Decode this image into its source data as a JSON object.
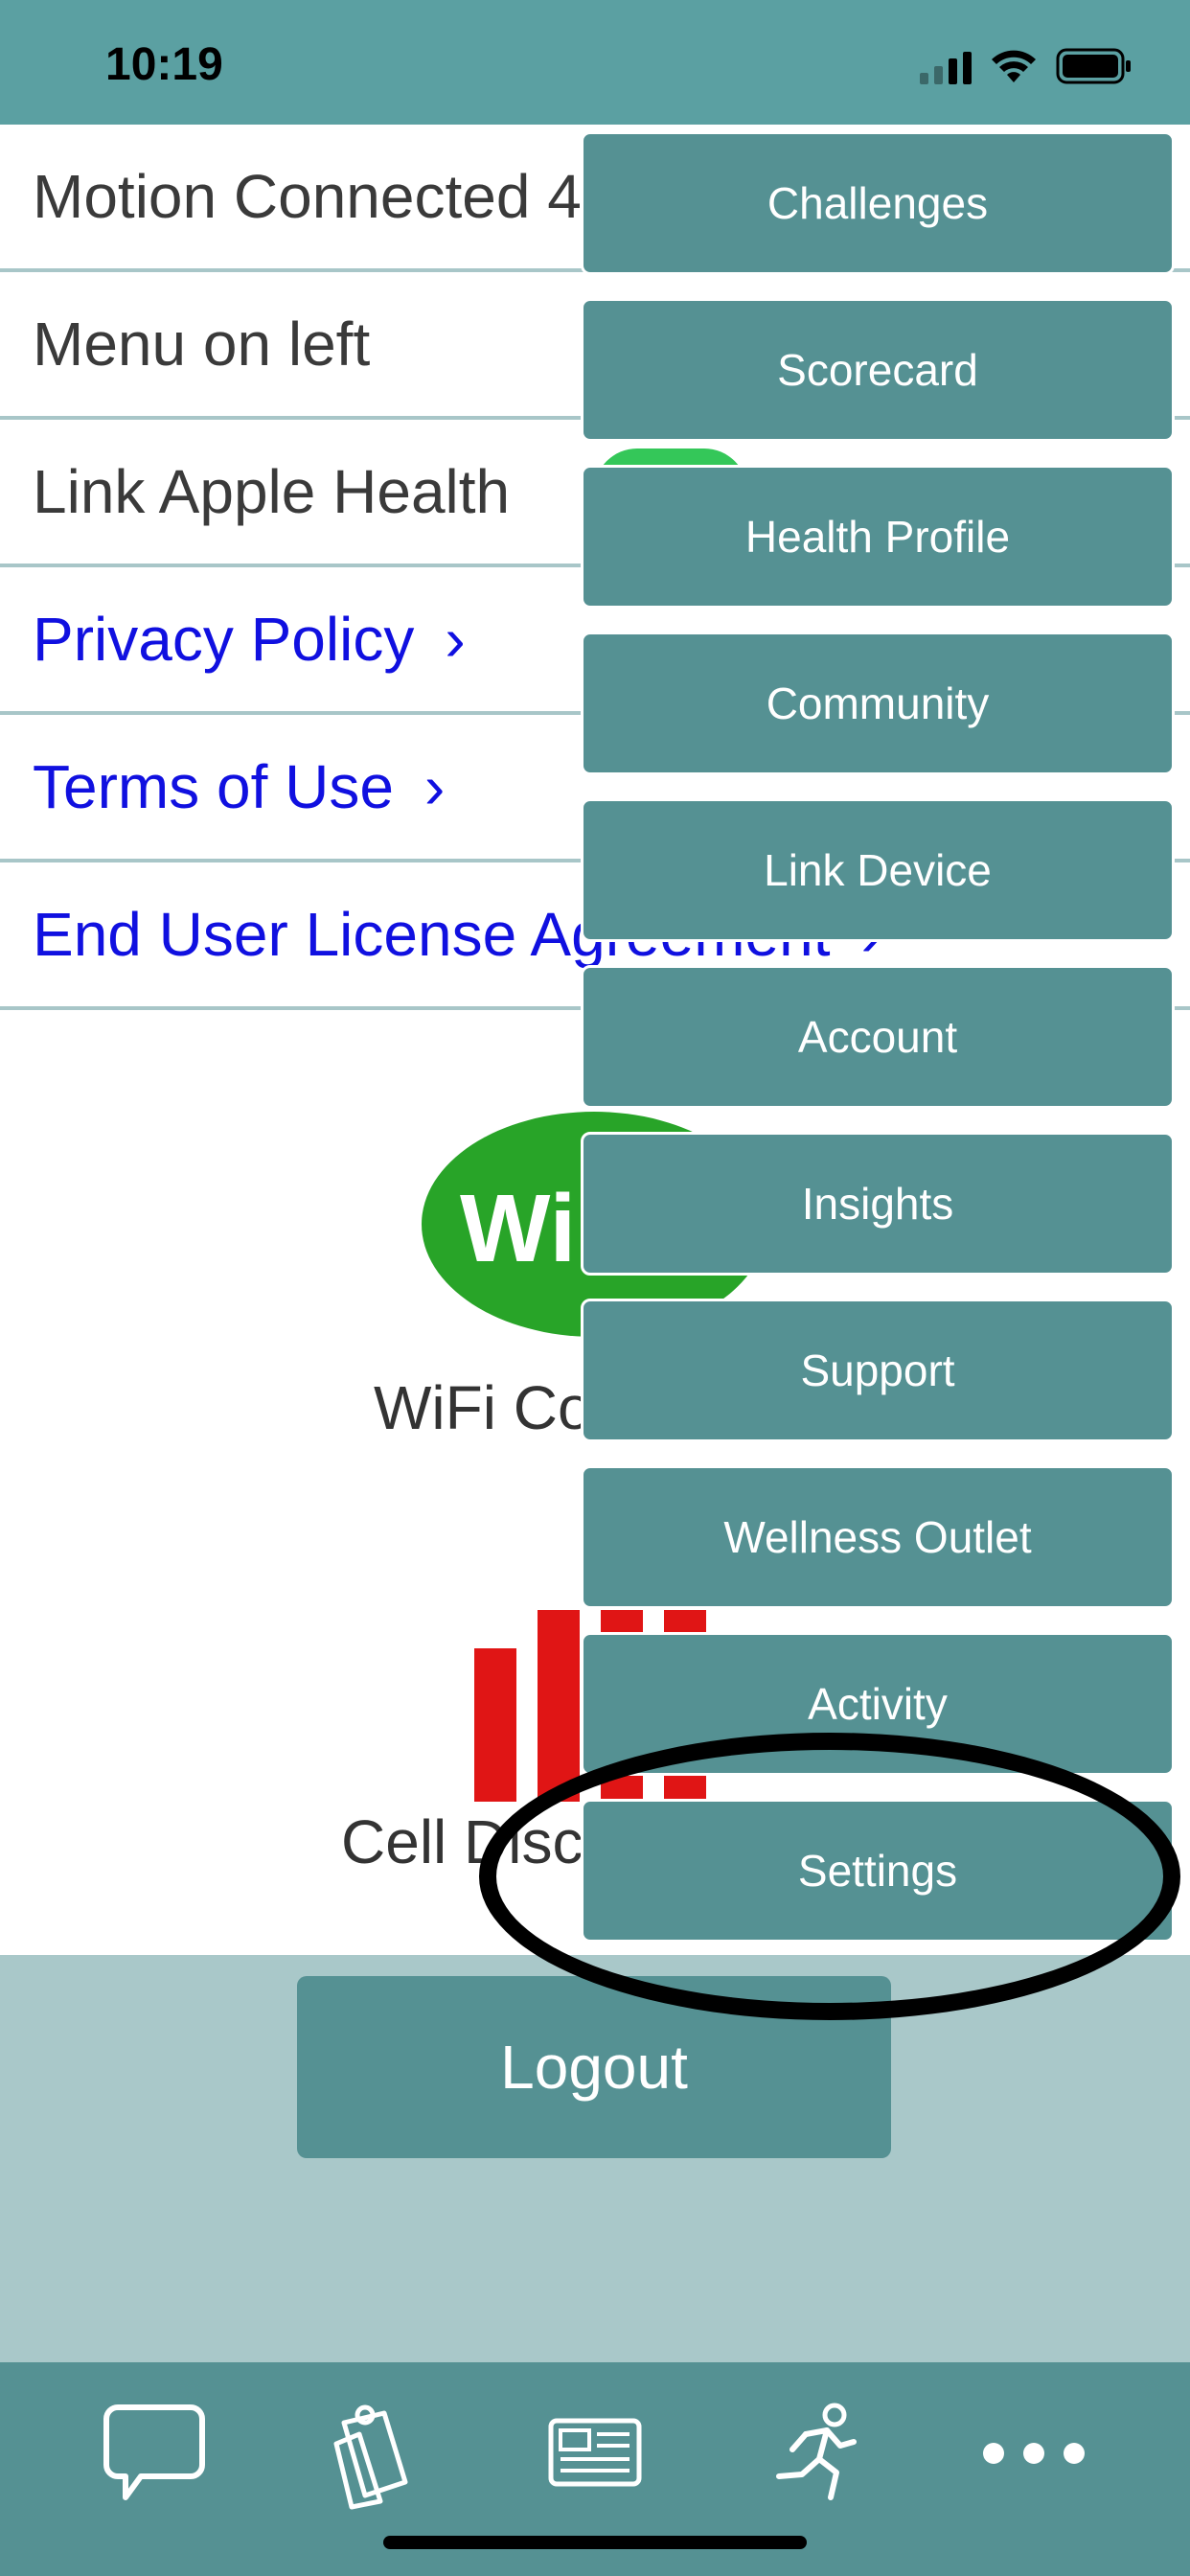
{
  "status_bar": {
    "time": "10:19"
  },
  "settings": {
    "rows": [
      {
        "label": "Motion Connected 4"
      },
      {
        "label": "Menu on left"
      },
      {
        "label": "Link Apple Health"
      }
    ],
    "links": [
      {
        "label": "Privacy Policy",
        "chevron": "›"
      },
      {
        "label": "Terms of Use",
        "chevron": "›"
      },
      {
        "label": "End User License Agreement",
        "chevron": "›"
      }
    ]
  },
  "background": {
    "wifi_badge_text": "Wi",
    "wifi_label": "WiFi Co",
    "cell_label": "Cell Disc"
  },
  "logout_label": "Logout",
  "menu": {
    "items": [
      {
        "label": "Challenges"
      },
      {
        "label": "Scorecard"
      },
      {
        "label": "Health Profile"
      },
      {
        "label": "Community"
      },
      {
        "label": "Link Device"
      },
      {
        "label": "Account"
      },
      {
        "label": "Insights"
      },
      {
        "label": "Support"
      },
      {
        "label": "Wellness Outlet"
      },
      {
        "label": "Activity"
      },
      {
        "label": "Settings"
      }
    ],
    "highlighted": "Settings"
  },
  "tab_bar": {
    "tabs": [
      {
        "icon": "chat-bubble-icon"
      },
      {
        "icon": "clipboard-icon"
      },
      {
        "icon": "news-card-icon"
      },
      {
        "icon": "running-figure-icon"
      },
      {
        "icon": "more-dots-icon"
      }
    ]
  },
  "colors": {
    "teal_header": "#5ba0a2",
    "teal_button": "#559193",
    "light_band": "#a9c8c9",
    "link_blue": "#1010e0",
    "wifi_green": "#28a428",
    "cell_red": "#e01515"
  }
}
